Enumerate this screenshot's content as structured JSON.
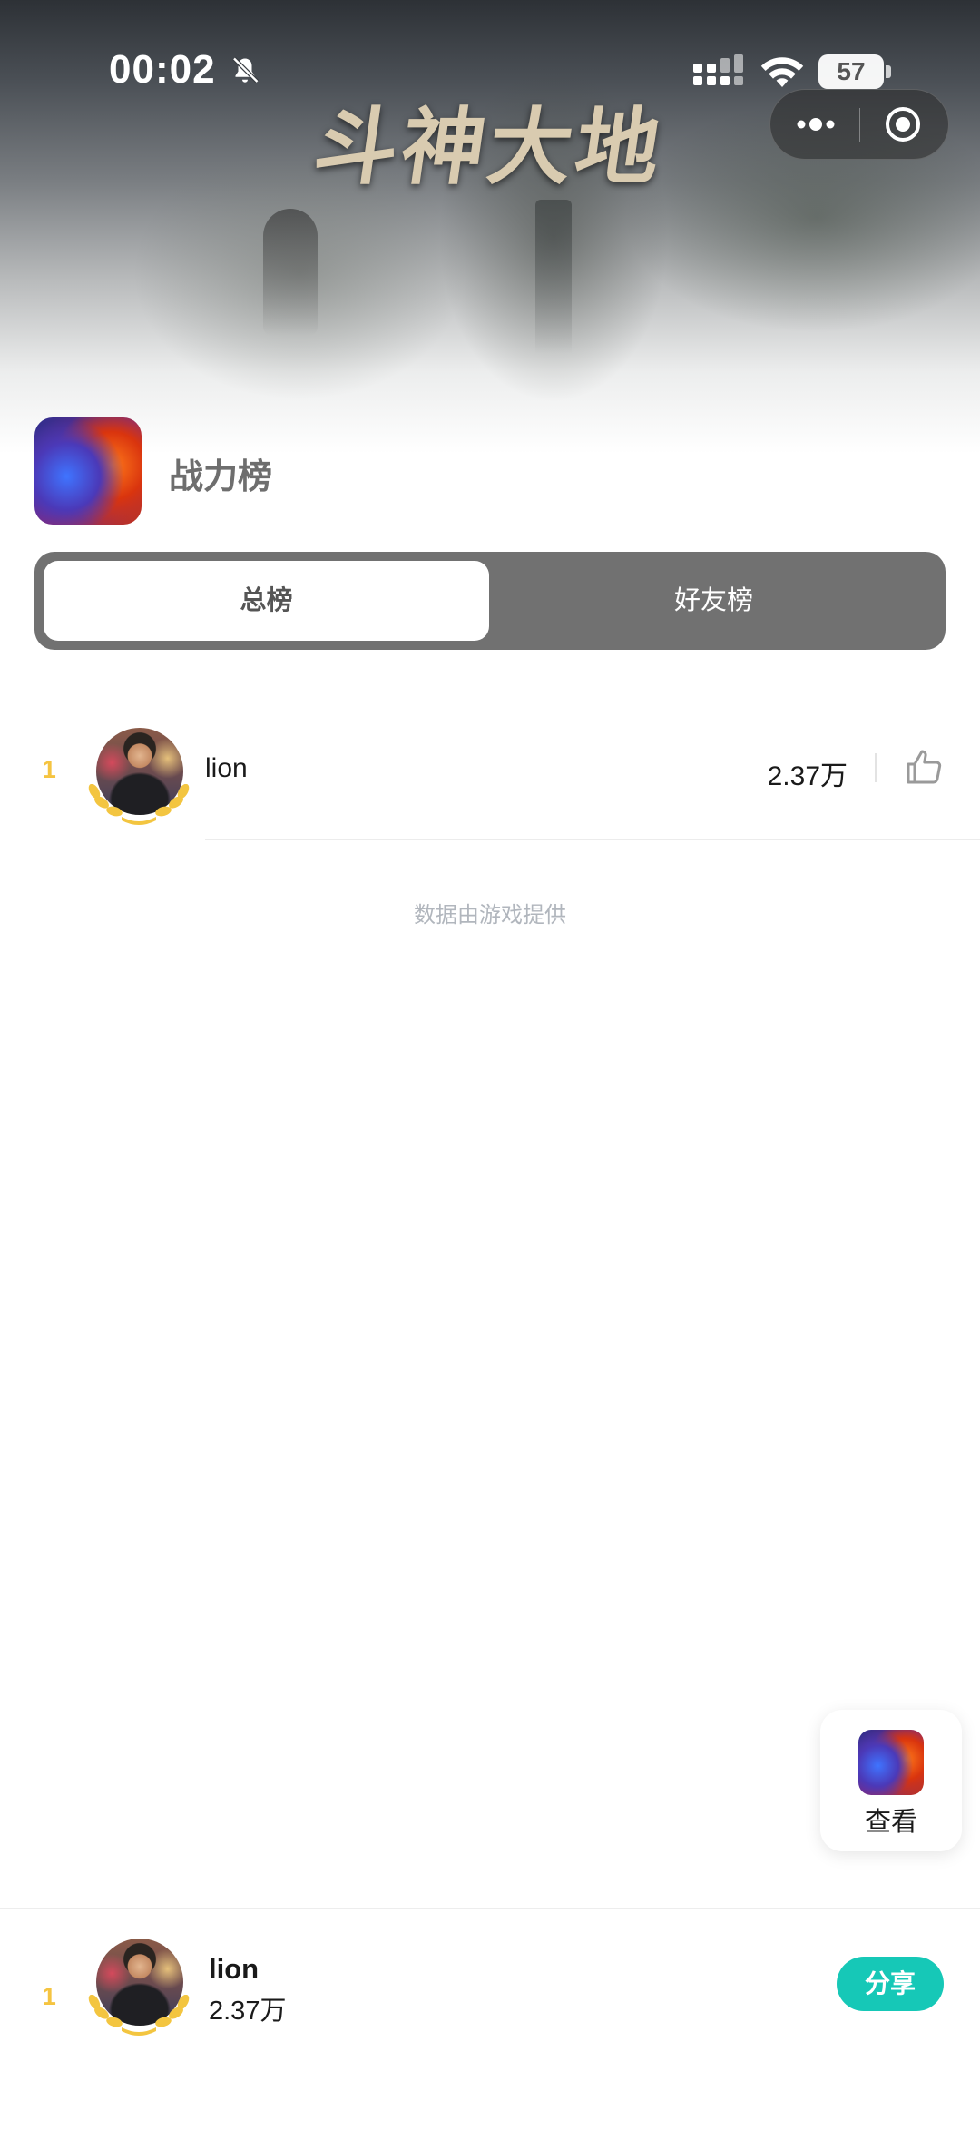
{
  "status_bar": {
    "time": "00:02",
    "battery": "57",
    "icons": [
      "bell-slash-icon",
      "cellular-signal-icon",
      "wifi-icon",
      "battery-icon"
    ]
  },
  "banner": {
    "logo_text": "斗神大地"
  },
  "capsule": {
    "icons": [
      "more-dots-icon",
      "close-target-icon"
    ]
  },
  "header": {
    "title": "战力榜"
  },
  "tabs": [
    {
      "label": "总榜",
      "selected": true
    },
    {
      "label": "好友榜",
      "selected": false
    }
  ],
  "ranking": [
    {
      "rank": "1",
      "name": "lion",
      "score": "2.37万"
    }
  ],
  "footer_note": "数据由游戏提供",
  "float_card": {
    "label": "查看"
  },
  "self": {
    "rank": "1",
    "name": "lion",
    "score": "2.37万",
    "share_label": "分享"
  },
  "colors": {
    "accent": "#16c8b7",
    "rank_gold": "#f5c441",
    "tab_bar": "#717171"
  }
}
